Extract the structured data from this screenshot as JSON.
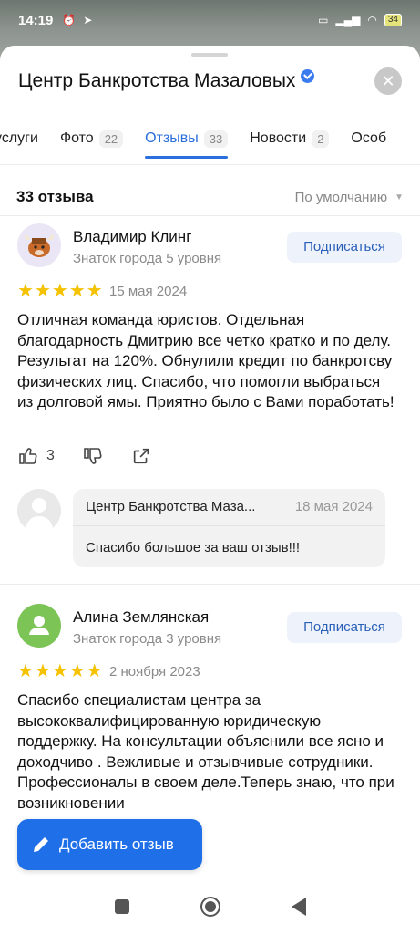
{
  "status_bar": {
    "time": "14:19",
    "battery": "34"
  },
  "header": {
    "title": "Центр Банкротства Мазаловых",
    "close_icon": "close-icon"
  },
  "tabs": [
    {
      "label": "услуги",
      "count": ""
    },
    {
      "label": "Фото",
      "count": "22"
    },
    {
      "label": "Отзывы",
      "count": "33"
    },
    {
      "label": "Новости",
      "count": "2"
    },
    {
      "label": "Особ",
      "count": ""
    }
  ],
  "summary": {
    "count_label": "33 отзыва",
    "sort_label": "По умолчанию"
  },
  "reviews": [
    {
      "name": "Владимир Клинг",
      "level": "Знаток города 5 уровня",
      "subscribe": "Подписаться",
      "rating": 5,
      "date": "15 мая 2024",
      "text": "Отличная команда юристов. Отдельная благодарность Дмитрию все четко кратко и по делу. Результат на 120%. Обнулили кредит по банкротсву физических лиц. Спасибо, что помогли выбраться из долговой ямы. Приятно было с Вами поработать!",
      "likes": "3",
      "reply": {
        "name": "Центр Банкротства Маза...",
        "date": "18 мая 2024",
        "text": "Спасибо большое за ваш отзыв!!!"
      }
    },
    {
      "name": "Алина Землянская",
      "level": "Знаток города 3 уровня",
      "subscribe": "Подписаться",
      "rating": 5,
      "date": "2 ноября 2023",
      "text": "Спасибо специалистам центра за высококвалифицированную юридическую поддержку. На консультации объяснили все ясно и доходчиво . Вежливые и отзывчивые сотрудники. Профессионалы в своем деле.Теперь знаю, что при возникновении"
    }
  ],
  "add_review_button": "Добавить отзыв",
  "colors": {
    "accent": "#2a6fdb",
    "star": "#f5c200",
    "button": "#1f6fe8"
  }
}
